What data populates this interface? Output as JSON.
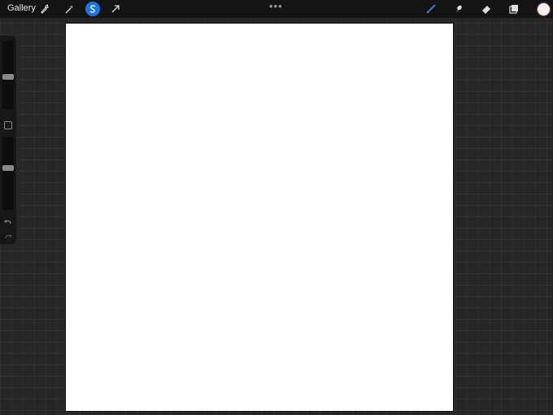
{
  "topbar": {
    "gallery_label": "Gallery",
    "left_tools": [
      {
        "name": "actions-wrench-icon"
      },
      {
        "name": "adjustments-wand-icon"
      },
      {
        "name": "selection-s-icon"
      },
      {
        "name": "transform-arrow-icon"
      }
    ],
    "more_label": "•••",
    "right_tools": [
      {
        "name": "brush-icon"
      },
      {
        "name": "smudge-icon"
      },
      {
        "name": "eraser-icon"
      },
      {
        "name": "layers-icon"
      }
    ]
  },
  "colors": {
    "accent": "#1d73e8",
    "active_brush": "#3c8cf0",
    "current_color": "#f8efea"
  },
  "sidebar": {
    "brush_size": 0.47,
    "opacity": 0.58,
    "undo_icon": "undo-arrow-icon",
    "redo_icon": "redo-arrow-icon"
  }
}
